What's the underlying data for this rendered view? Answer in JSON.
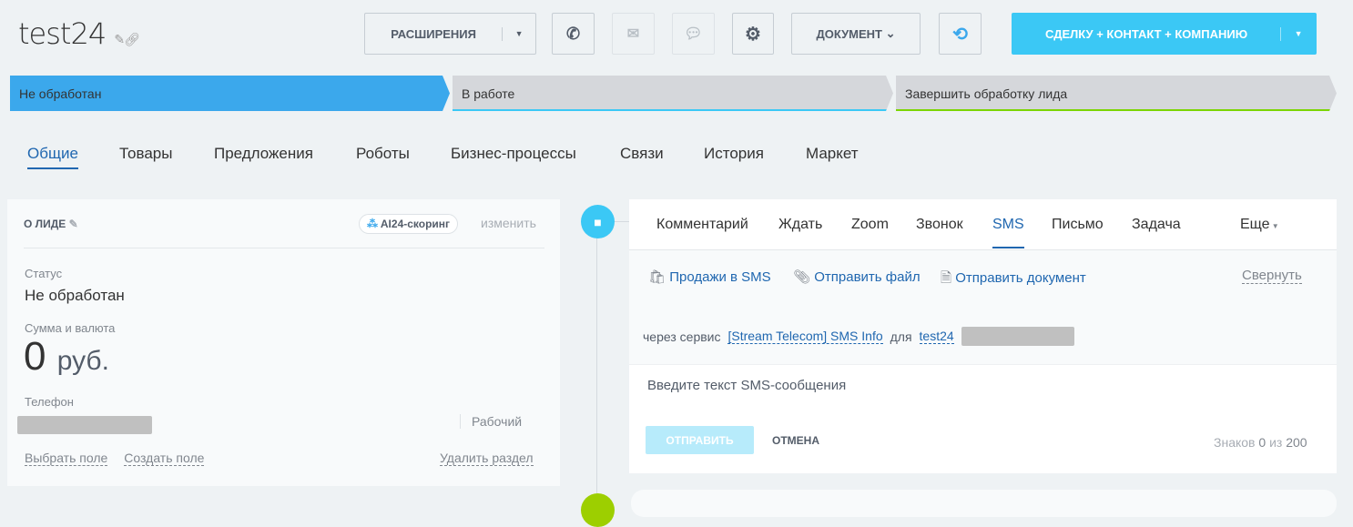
{
  "header": {
    "title": "test24",
    "extensions": "РАСШИРЕНИЯ",
    "document": "ДОКУМЕНТ",
    "create": "СДЕЛКУ + КОНТАКТ + КОМПАНИЮ"
  },
  "stages": [
    "Не обработан",
    "В работе",
    "Завершить обработку лида"
  ],
  "tabs": [
    "Общие",
    "Товары",
    "Предложения",
    "Роботы",
    "Бизнес-процессы",
    "Связи",
    "История",
    "Маркет"
  ],
  "lead": {
    "heading": "О ЛИДЕ",
    "scoring": "AI24-скоринг",
    "change": "изменить",
    "status_label": "Статус",
    "status": "Не обработан",
    "sum_label": "Сумма и валюта",
    "sum": "0",
    "currency": "руб.",
    "phone_label": "Телефон",
    "phone_type": "Рабочий",
    "select_field": "Выбрать поле",
    "create_field": "Создать поле",
    "delete_section": "Удалить раздел"
  },
  "activity": {
    "tabs": [
      "Комментарий",
      "Ждать",
      "Zoom",
      "Звонок",
      "SMS",
      "Письмо",
      "Задача"
    ],
    "more": "Еще",
    "sales_sms": "Продажи в SMS",
    "send_file": "Отправить файл",
    "send_doc": "Отправить документ",
    "collapse": "Свернуть",
    "via": "через сервис",
    "service": "[Stream Telecom] SMS Info",
    "for": "для",
    "recipient": "test24",
    "placeholder": "Введите текст SMS-сообщения",
    "send": "ОТПРАВИТЬ",
    "cancel": "ОТМЕНА",
    "chars_label": "Знаков",
    "chars": "0",
    "of": "из",
    "max": "200"
  }
}
